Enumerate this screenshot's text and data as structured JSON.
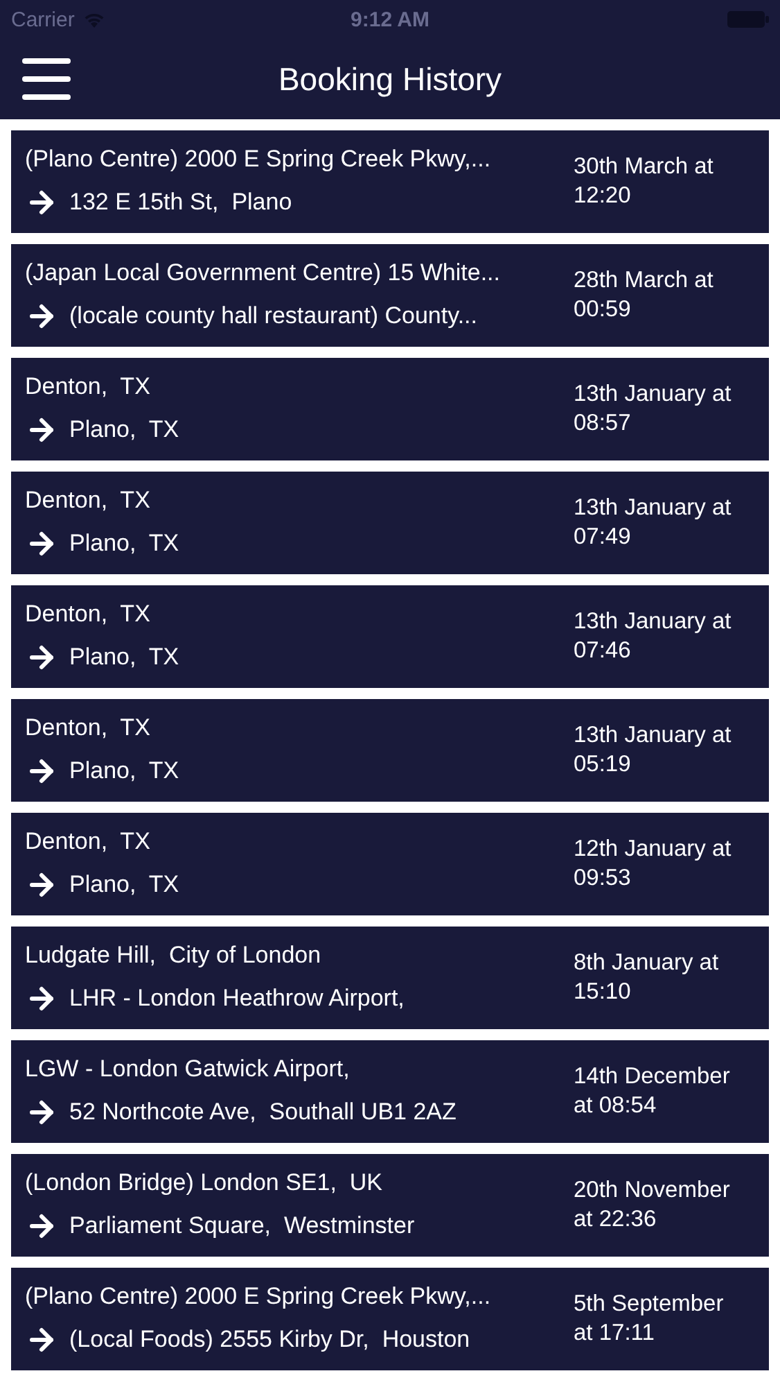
{
  "status_bar": {
    "carrier": "Carrier",
    "time": "9:12 AM"
  },
  "nav": {
    "title": "Booking History"
  },
  "bookings": [
    {
      "from": "(Plano Centre) 2000 E Spring Creek Pkwy,...",
      "to": "132 E 15th St,  Plano",
      "when": "30th March at\n12:20"
    },
    {
      "from": "(Japan Local Government Centre) 15 White...",
      "to": "(locale county hall restaurant) County...",
      "when": "28th March at\n00:59"
    },
    {
      "from": "Denton,  TX",
      "to": "Plano,  TX",
      "when": "13th January at\n08:57"
    },
    {
      "from": "Denton,  TX",
      "to": "Plano,  TX",
      "when": "13th January at\n07:49"
    },
    {
      "from": "Denton,  TX",
      "to": "Plano,  TX",
      "when": "13th January at\n07:46"
    },
    {
      "from": "Denton,  TX",
      "to": "Plano,  TX",
      "when": "13th January at\n05:19"
    },
    {
      "from": "Denton,  TX",
      "to": "Plano,  TX",
      "when": "12th January at\n09:53"
    },
    {
      "from": "Ludgate Hill,  City of London",
      "to": "LHR - London Heathrow Airport,",
      "when": "8th January at\n15:10"
    },
    {
      "from": "LGW - London Gatwick Airport,",
      "to": "52 Northcote Ave,  Southall UB1 2AZ",
      "when": "14th December\nat 08:54"
    },
    {
      "from": "(London Bridge) London SE1,  UK",
      "to": "Parliament Square,  Westminster",
      "when": "20th November\nat 22:36"
    },
    {
      "from": "(Plano Centre) 2000 E Spring Creek Pkwy,...",
      "to": "(Local Foods) 2555 Kirby Dr,  Houston",
      "when": "5th September\nat 17:11"
    }
  ]
}
